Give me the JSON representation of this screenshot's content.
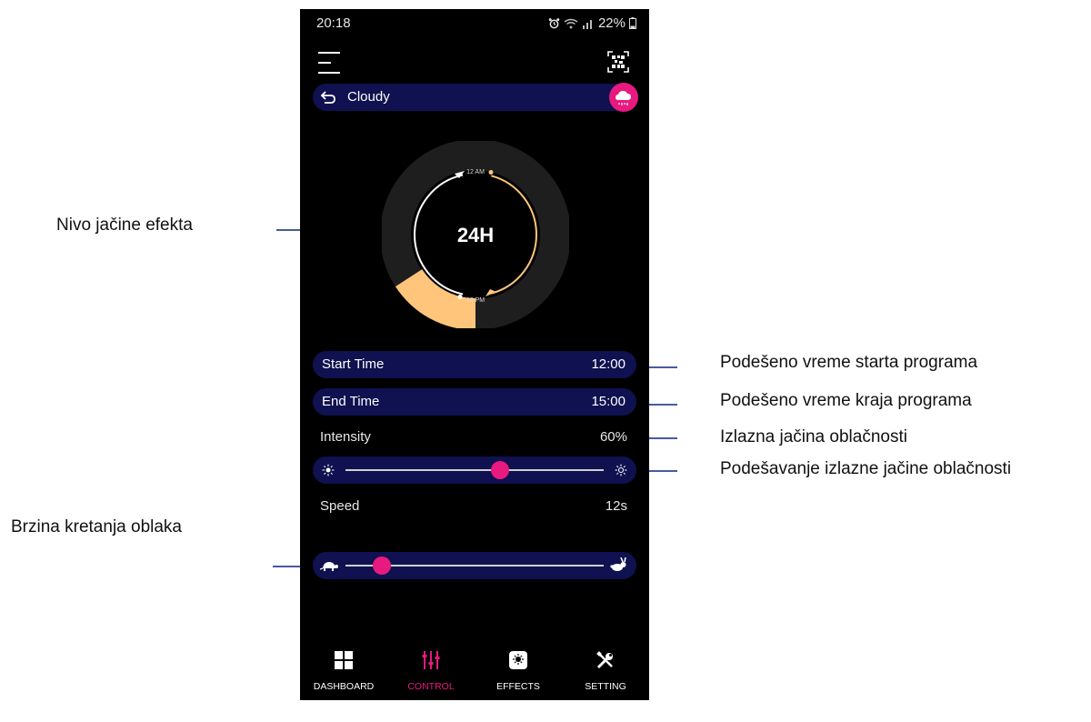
{
  "status_bar": {
    "time": "20:18",
    "battery": "22%"
  },
  "header": {
    "menu_icon": "hamburger-icon",
    "qr_icon": "qr-code-icon"
  },
  "effect_bar": {
    "back_icon": "back-arrow-icon",
    "title": "Cloudy",
    "badge_icon": "cloud-rain-icon",
    "badge_color": "#e8197f"
  },
  "clock": {
    "center_label": "24H",
    "top_label": "12 AM",
    "bottom_label": "12 PM",
    "arc_color": "#ffc57a",
    "ring_color": "#1e1e1e"
  },
  "settings": {
    "start_time": {
      "label": "Start Time",
      "value": "12:00"
    },
    "end_time": {
      "label": "End Time",
      "value": "15:00"
    },
    "intensity": {
      "label": "Intensity",
      "value": "60%",
      "level": 0.6
    },
    "speed": {
      "label": "Speed",
      "value": "12s",
      "level": 0.14
    }
  },
  "tabs": [
    {
      "label": "DASHBOARD",
      "icon": "dashboard-grid-icon"
    },
    {
      "label": "CONTROL",
      "icon": "sliders-icon",
      "active": true
    },
    {
      "label": "EFFECTS",
      "icon": "effects-icon"
    },
    {
      "label": "SETTING",
      "icon": "tools-icon"
    }
  ],
  "annotations": {
    "effect_level": "Nivo jačine efekta",
    "start_time": "Podešeno vreme starta programa",
    "end_time": "Podešeno vreme kraja programa",
    "intensity_output": "Izlazna jačina oblačnosti",
    "intensity_adjust": "Podešavanje izlazne jačine oblačnosti",
    "cloud_speed": "Brzina kretanja oblaka"
  },
  "colors": {
    "accent": "#e8197f",
    "pill": "#0f1150",
    "annotation_line": "#4a5aa0"
  }
}
